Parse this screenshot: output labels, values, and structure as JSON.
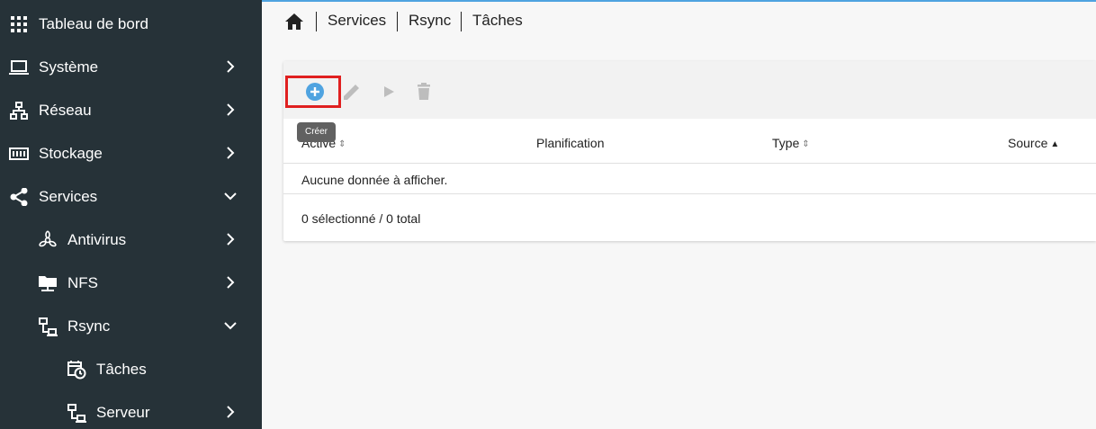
{
  "sidebar": {
    "items": [
      {
        "label": "Tableau de bord"
      },
      {
        "label": "Système"
      },
      {
        "label": "Réseau"
      },
      {
        "label": "Stockage"
      },
      {
        "label": "Services"
      },
      {
        "label": "Antivirus"
      },
      {
        "label": "NFS"
      },
      {
        "label": "Rsync"
      },
      {
        "label": "Tâches"
      },
      {
        "label": "Serveur"
      }
    ]
  },
  "breadcrumb": {
    "items": [
      "Services",
      "Rsync",
      "Tâches"
    ]
  },
  "toolbar": {
    "tooltip": "Créer",
    "buttons": [
      "add-circle-icon",
      "pencil-icon",
      "play-icon",
      "trash-icon"
    ]
  },
  "table": {
    "columns": [
      "Activé",
      "Planification",
      "Type",
      "Source"
    ],
    "empty_message": "Aucune donnée à afficher.",
    "footer": "0 sélectionné / 0 total"
  },
  "colors": {
    "sidebar_bg": "#263238",
    "accent": "#4fa3e0",
    "highlight": "#e02020"
  }
}
